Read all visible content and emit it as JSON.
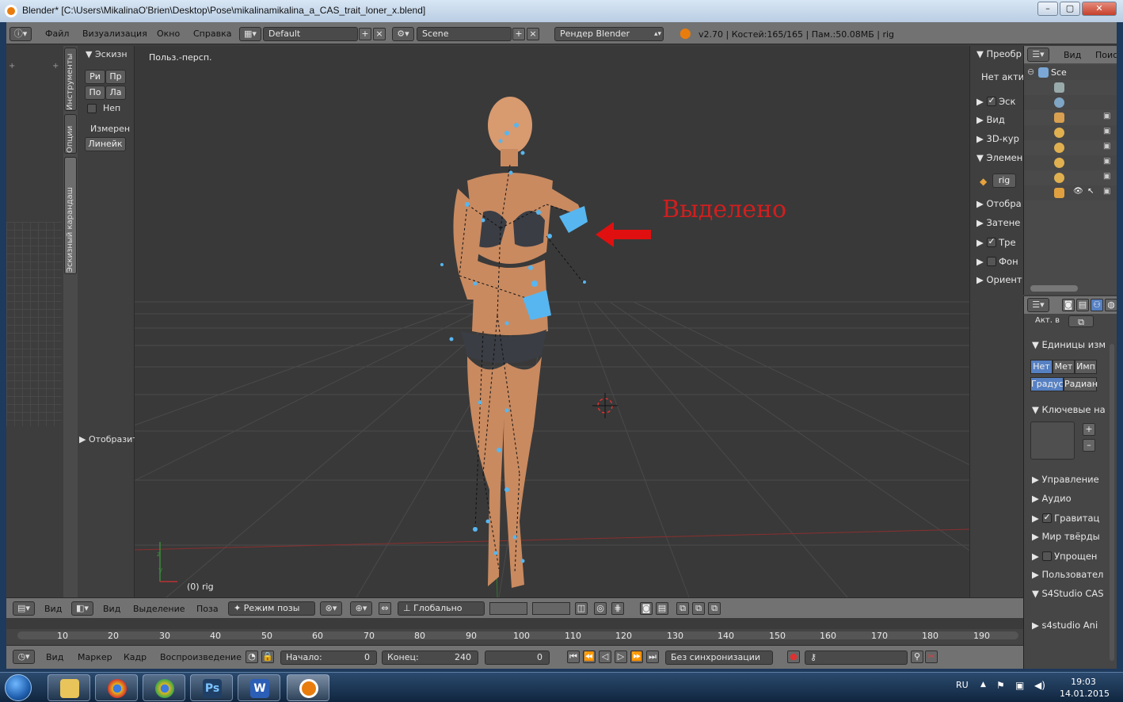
{
  "window": {
    "title": "Blender* [C:\\Users\\MikalinaO'Brien\\Desktop\\Pose\\mikalinamikalina_a_CAS_trait_loner_x.blend]",
    "controls": [
      "–",
      "▢",
      "✕"
    ]
  },
  "menu": [
    "Файл",
    "Визуализация",
    "Окно",
    "Справка"
  ],
  "layout": {
    "screen": "Default",
    "scene": "Scene",
    "engine": "Рендер Blender"
  },
  "stats": "v2.70 | Костей:165/165  | Пам.:50.08МБ | rig",
  "left_tabs": [
    "Инструменты",
    "Опции",
    "Эскизный карандаш"
  ],
  "shelf": {
    "panel_title": "Эскизн",
    "buttons": [
      "Ри",
      "Пр",
      "По",
      "Ла"
    ],
    "checkbox_label": "Неп",
    "measure_label": "Измерен",
    "ruler_button": "Линейк",
    "display_panel": "Отобразит"
  },
  "viewport": {
    "view_label": "Польз.-персп.",
    "object_label": "(0) rig",
    "annotation": "Выделено"
  },
  "npanel": {
    "items": [
      "Преобр",
      "Нет акти",
      "Эск",
      "Вид",
      "3D-кур",
      "Элемен",
      "rig",
      "Отобра",
      "Затене",
      "Тре",
      "Фон",
      "Ориент"
    ]
  },
  "outliner": {
    "header": [
      "Вид",
      "Поис"
    ],
    "root": "Sce"
  },
  "properties": {
    "act_label": "Акт. в",
    "units_panel": "Единицы изм",
    "units": [
      "Нет",
      "Мет",
      "Имп"
    ],
    "angles": [
      "Градус",
      "Радиан"
    ],
    "keying_panel": "Ключевые на",
    "sections": [
      "Управление",
      "Аудио",
      "Гравитац",
      "Мир твёрды",
      "Упрощен",
      "Пользовател",
      "S4Studio CAS",
      "s4studio Ani"
    ]
  },
  "view3d_header": {
    "items": [
      "Вид",
      "Вид",
      "Выделение",
      "Поза"
    ],
    "mode": "Режим позы",
    "orientation": "Глобально"
  },
  "timeline": {
    "ticks": [
      "10",
      "20",
      "30",
      "40",
      "50",
      "60",
      "70",
      "80",
      "90",
      "100",
      "110",
      "120",
      "130",
      "140",
      "150",
      "160",
      "170",
      "180",
      "190"
    ],
    "header_items": [
      "Вид",
      "Маркер",
      "Кадр",
      "Воспроизведение"
    ],
    "start_label": "Начало:",
    "start_value": "0",
    "end_label": "Конец:",
    "end_value": "240",
    "current_value": "0",
    "sync": "Без синхронизации"
  },
  "taskbar": {
    "apps": [
      "explorer-icon",
      "chrome-icon",
      "chrome-icon",
      "photoshop-icon",
      "word-icon",
      "blender-icon"
    ],
    "app_glyphs": [
      "",
      "",
      "",
      "Ps",
      "W",
      ""
    ],
    "lang": "RU",
    "time": "19:03",
    "date": "14.01.2015"
  }
}
